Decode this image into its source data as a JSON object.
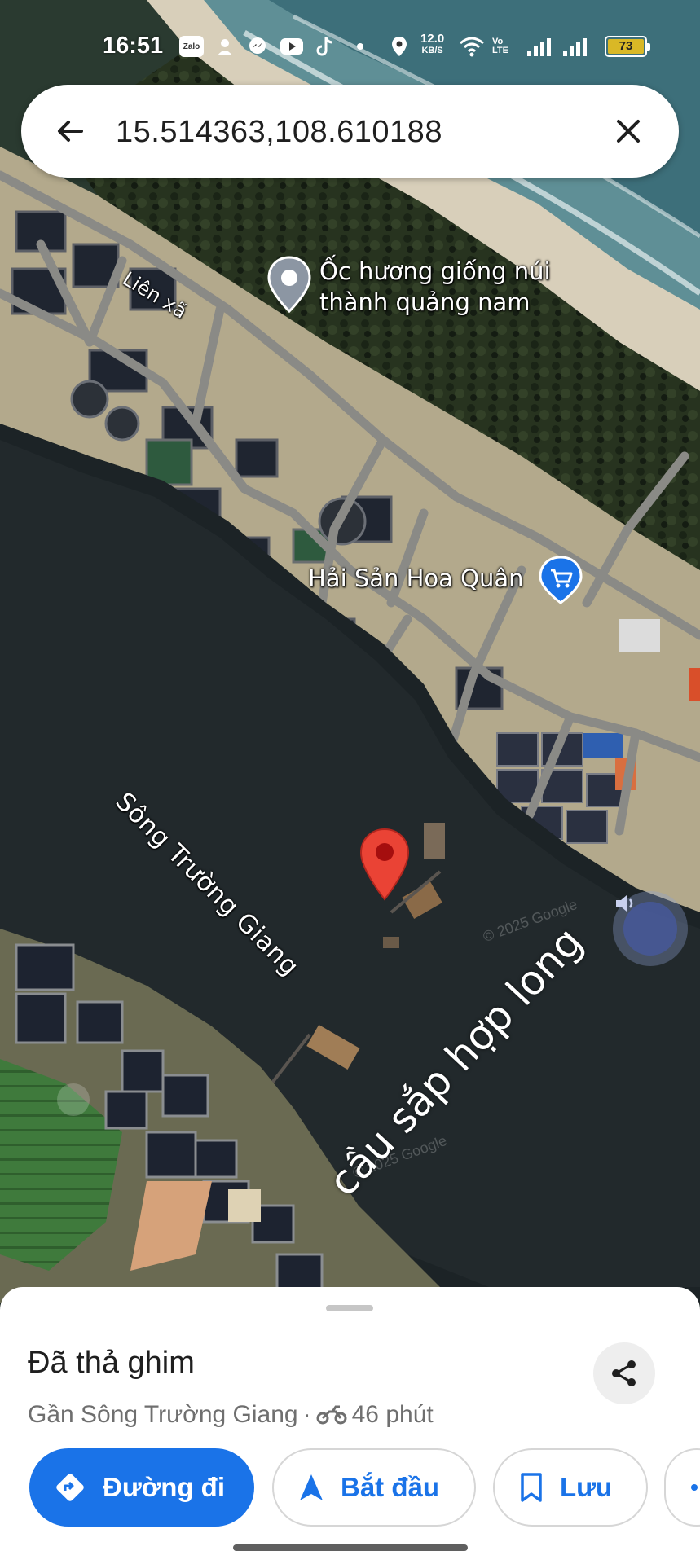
{
  "status_bar": {
    "time": "16:51",
    "speed_value": "12.0",
    "speed_unit": "KB/S",
    "network_label": "Vo LTE",
    "battery_level": "73",
    "icons": [
      "zalo-icon",
      "contacts-icon",
      "messenger-icon",
      "youtube-icon",
      "tiktok-icon",
      "dot-icon",
      "location-icon",
      "wifi-icon",
      "signal-icon",
      "battery-icon"
    ]
  },
  "search": {
    "query": "15.514363,108.610188",
    "back_icon": "arrow-back-icon",
    "clear_icon": "close-icon"
  },
  "map": {
    "road_label": "Liên xã",
    "poi_label": "Ốc hương giống núi thành quảng nam",
    "shop_label": "Hải Sản Hoa Quân",
    "river_label": "Sông Trường Giang",
    "annotation": "cầu sắp hợp long",
    "watermark": "© 2025 Google",
    "pin_color": "#ea4335",
    "shop_pin_color": "#1a73e8"
  },
  "sheet": {
    "title": "Đã thả ghim",
    "subtitle_place": "Gần Sông Trường Giang",
    "separator": "·",
    "travel_time": "46 phút",
    "buttons": {
      "directions": "Đường đi",
      "start": "Bắt đầu",
      "save": "Lưu"
    },
    "accent": "#1a73e8"
  }
}
